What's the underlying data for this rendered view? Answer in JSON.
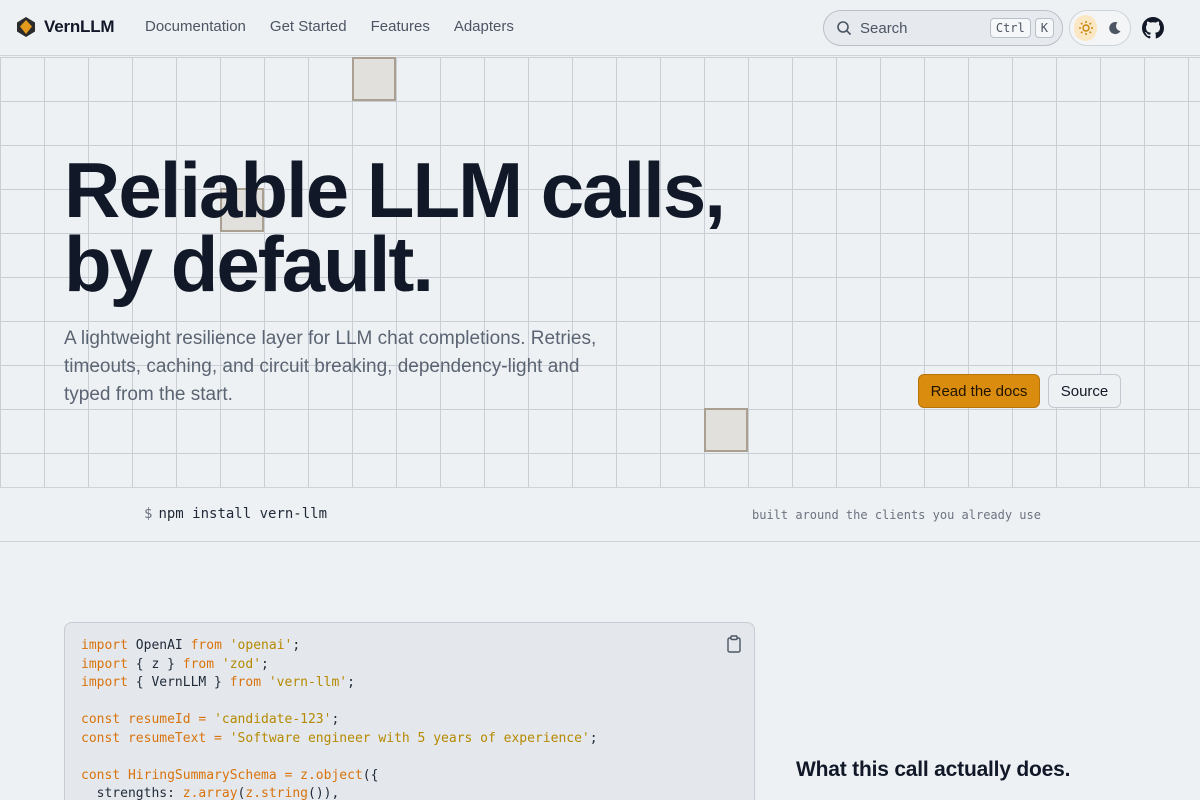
{
  "nav": {
    "brand": "VernLLM",
    "links": [
      "Documentation",
      "Get Started",
      "Features",
      "Adapters"
    ],
    "search": {
      "label": "Search",
      "shortcut": [
        "Ctrl",
        "K"
      ]
    },
    "theme": {
      "active": "light",
      "options": [
        "sun-icon",
        "moon-icon"
      ]
    },
    "github_icon": "github-icon"
  },
  "hero": {
    "headline_line1": "Reliable LLM calls,",
    "headline_line2": "by default.",
    "subtitle": "A lightweight resilience layer for LLM chat completions. Retries, timeouts, caching, and circuit breaking, dependency-light and typed from the start.",
    "primary_cta": "Read the docs",
    "secondary_cta": "Source"
  },
  "install": {
    "prompt": "$",
    "command": "npm install vern-llm",
    "note": "built around the clients you already use"
  },
  "code": {
    "copy_icon": "clipboard-icon",
    "lines": [
      [
        {
          "t": "import",
          "c": "k"
        },
        {
          "t": " OpenAI ",
          "c": "p"
        },
        {
          "t": "from",
          "c": "k"
        },
        {
          "t": " ",
          "c": "p"
        },
        {
          "t": "'openai'",
          "c": "s"
        },
        {
          "t": ";",
          "c": "p"
        }
      ],
      [
        {
          "t": "import",
          "c": "k"
        },
        {
          "t": " { z } ",
          "c": "p"
        },
        {
          "t": "from",
          "c": "k"
        },
        {
          "t": " ",
          "c": "p"
        },
        {
          "t": "'zod'",
          "c": "s"
        },
        {
          "t": ";",
          "c": "p"
        }
      ],
      [
        {
          "t": "import",
          "c": "k"
        },
        {
          "t": " { VernLLM } ",
          "c": "p"
        },
        {
          "t": "from",
          "c": "k"
        },
        {
          "t": " ",
          "c": "p"
        },
        {
          "t": "'vern-llm'",
          "c": "s"
        },
        {
          "t": ";",
          "c": "p"
        }
      ],
      [],
      [
        {
          "t": "const",
          "c": "k"
        },
        {
          "t": " resumeId = ",
          "c": "v"
        },
        {
          "t": "'candidate-123'",
          "c": "s"
        },
        {
          "t": ";",
          "c": "p"
        }
      ],
      [
        {
          "t": "const",
          "c": "k"
        },
        {
          "t": " resumeText = ",
          "c": "v"
        },
        {
          "t": "'Software engineer with 5 years of experience'",
          "c": "s"
        },
        {
          "t": ";",
          "c": "p"
        }
      ],
      [],
      [
        {
          "t": "const",
          "c": "k"
        },
        {
          "t": " HiringSummarySchema = ",
          "c": "v"
        },
        {
          "t": "z.object",
          "c": "f"
        },
        {
          "t": "({",
          "c": "p"
        }
      ],
      [
        {
          "t": "  strengths: ",
          "c": "p"
        },
        {
          "t": "z.array",
          "c": "f"
        },
        {
          "t": "(",
          "c": "p"
        },
        {
          "t": "z.string",
          "c": "f"
        },
        {
          "t": "()),",
          "c": "p"
        }
      ]
    ]
  },
  "side": {
    "heading": "What this call actually does."
  },
  "colors": {
    "accent": "#d98c0e",
    "background": "#eef1f4",
    "text": "#111827",
    "muted": "#5b6472"
  }
}
